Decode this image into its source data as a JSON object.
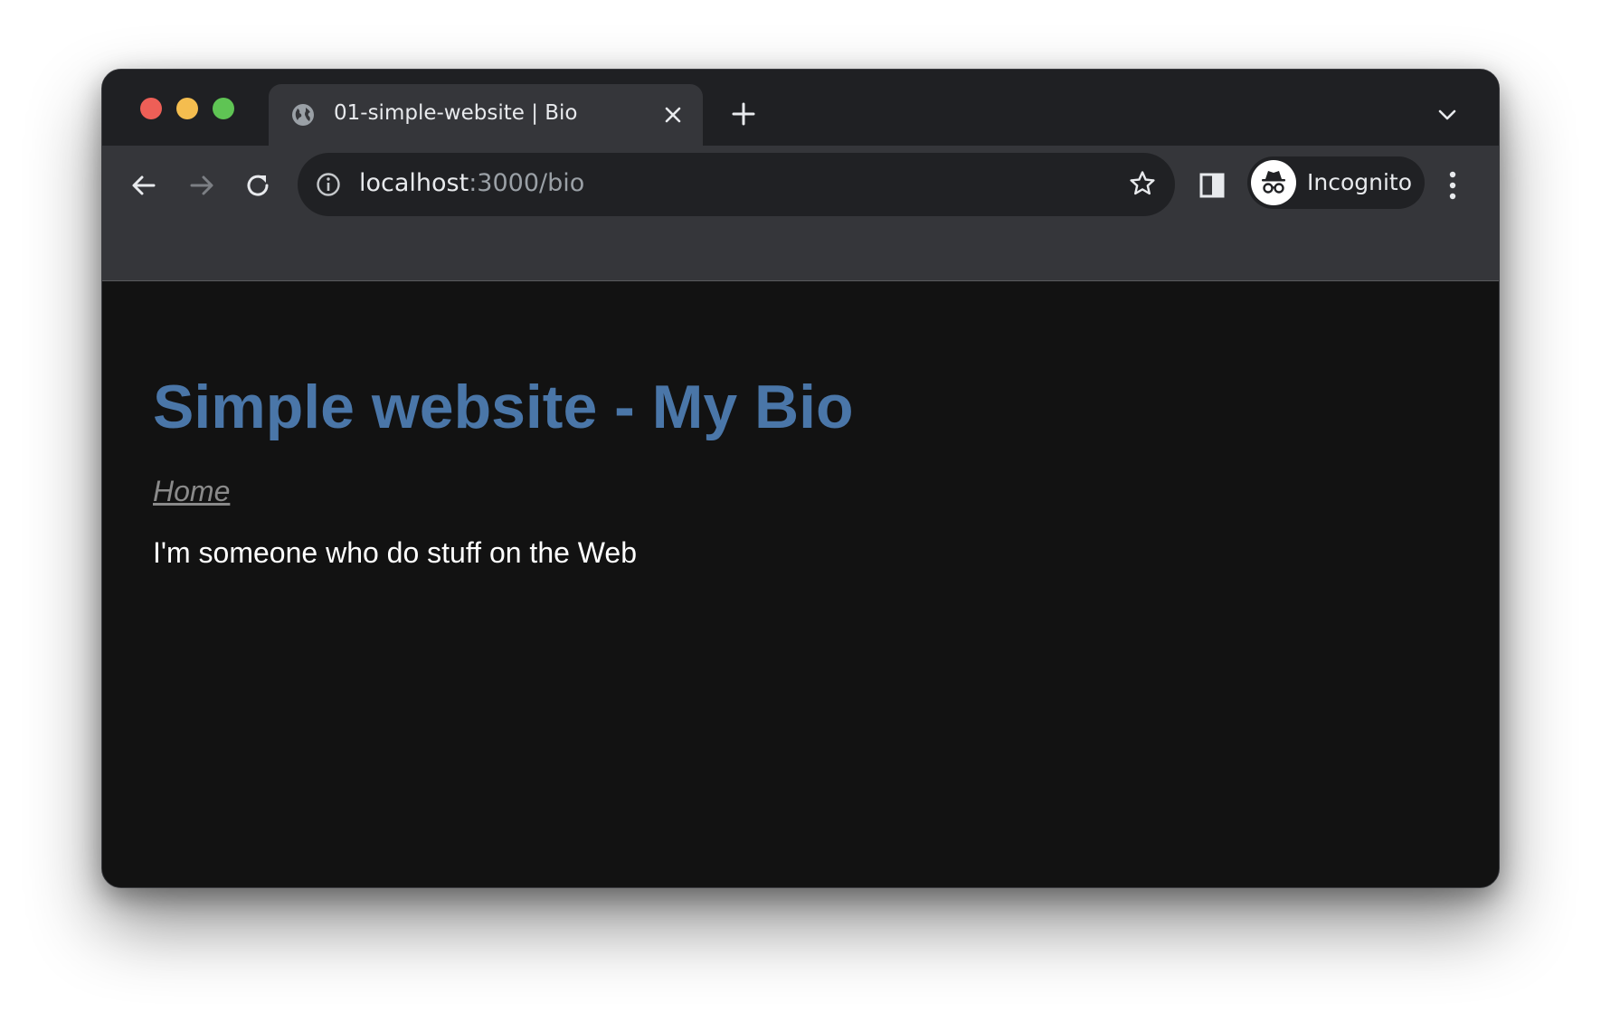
{
  "browser": {
    "tab": {
      "title": "01-simple-website | Bio",
      "favicon": "globe-icon"
    },
    "address_bar": {
      "host": "localhost",
      "rest": ":3000/bio"
    },
    "profile": {
      "label": "Incognito",
      "icon": "incognito-icon"
    },
    "icons": {
      "back": "back-arrow-icon",
      "forward": "forward-arrow-icon",
      "reload": "reload-icon",
      "info": "info-icon",
      "bookmark": "star-icon",
      "side_panel": "side-panel-icon",
      "menu": "kebab-menu-icon",
      "new_tab": "plus-icon",
      "tab_search": "chevron-down-icon",
      "close_tab": "close-icon"
    },
    "colors": {
      "tabstrip_bg": "#1f2023",
      "toolbar_bg": "#35363a",
      "omnibox_bg": "#202124",
      "traffic_red": "#ee5f57",
      "traffic_yellow": "#f4bd4f",
      "traffic_green": "#5fc454"
    }
  },
  "page": {
    "heading": "Simple website - My Bio",
    "nav_link": "Home",
    "bio": "I'm someone who do stuff on the Web",
    "colors": {
      "background": "#121212",
      "heading": "#4a76a8",
      "link": "#8a8a8a",
      "text": "#ffffff"
    }
  }
}
